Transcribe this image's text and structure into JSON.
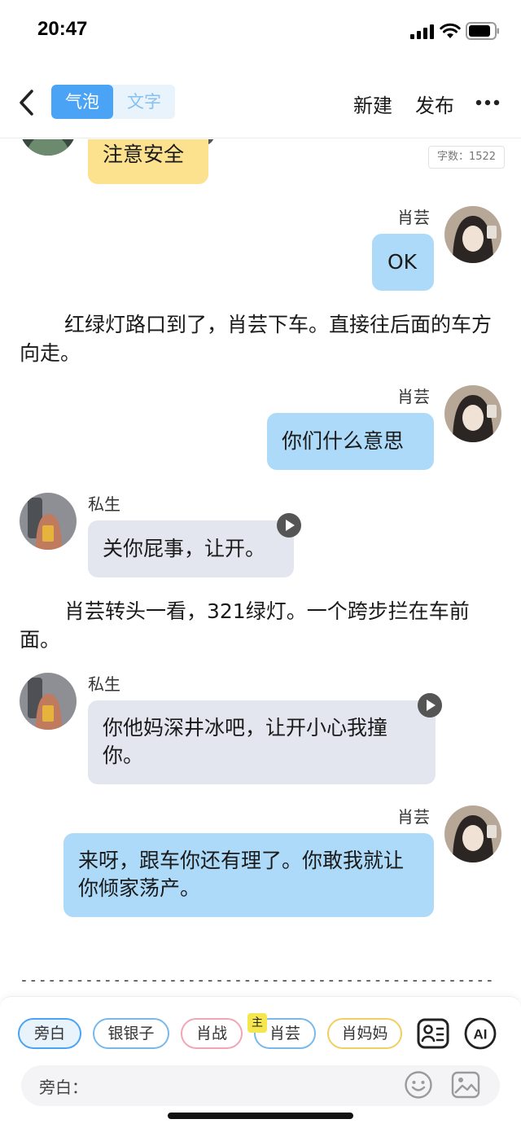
{
  "status_bar": {
    "time": "20:47"
  },
  "nav": {
    "mode_bubble_label": "气泡",
    "mode_text_label": "文字",
    "new_label": "新建",
    "publish_label": "发布"
  },
  "editor": {
    "word_count": "字数：1522",
    "messages": [
      {
        "type": "bubble",
        "speaker": "",
        "text": "注意安全",
        "color": "#fce18f"
      },
      {
        "type": "bubble",
        "speaker": "肖芸",
        "text": "OK",
        "color": "#addaf8"
      },
      {
        "type": "narration",
        "text": "红绿灯路口到了，肖芸下车。直接往后面的车方向走。"
      },
      {
        "type": "bubble",
        "speaker": "肖芸",
        "text": "你们什么意思",
        "color": "#addaf8"
      },
      {
        "type": "bubble",
        "speaker": "私生",
        "text": "关你屁事，让开。",
        "color": "#e3e6ee"
      },
      {
        "type": "narration",
        "text": "肖芸转头一看，321绿灯。一个跨步拦在车前面。"
      },
      {
        "type": "bubble",
        "speaker": "私生",
        "text": "你他妈深井冰吧，让开小心我撞你。",
        "color": "#e3e6ee"
      },
      {
        "type": "bubble",
        "speaker": "肖芸",
        "text": "来呀，跟车你还有理了。你敢我就让你倾家荡产。",
        "color": "#addaf8"
      }
    ],
    "divider": "----------------------------------------------------------------"
  },
  "characters": {
    "narrator": "旁白",
    "items": [
      "银银子",
      "肖战",
      "肖芸",
      "肖妈妈"
    ],
    "main_badge": "主",
    "ai_label": "AI"
  },
  "input": {
    "label": "旁白："
  }
}
